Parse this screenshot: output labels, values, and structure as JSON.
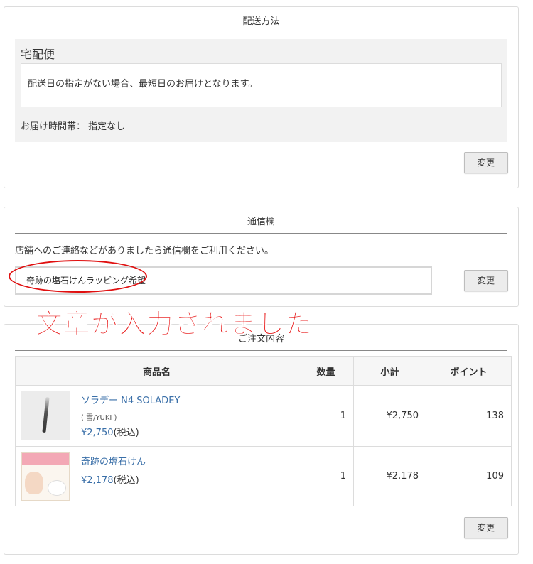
{
  "delivery": {
    "title": "配送方法",
    "method": "宅配便",
    "note": "配送日の指定がない場合、最短日のお届けとなります。",
    "time_label": "お届け時間帯：",
    "time_value": "指定なし",
    "change_label": "変更"
  },
  "message": {
    "title": "通信欄",
    "description": "店舗へのご連絡などがありましたら通信欄をご利用ください。",
    "input_value": "奇跡の塩石けんラッピング希望",
    "change_label": "変更",
    "highlight_color": "#e01010"
  },
  "annotation": {
    "text": "文章が入力されました",
    "color": "#e81818"
  },
  "order": {
    "title": "ご注文内容",
    "columns": [
      "商品名",
      "数量",
      "小計",
      "ポイント"
    ],
    "items": [
      {
        "name": "ソラデー N4 SOLADEY",
        "variant": "( 雪/YUKI )",
        "price": "¥2,750",
        "tax": "(税込)",
        "quantity": "1",
        "subtotal": "¥2,750",
        "points": "138"
      },
      {
        "name": "奇跡の塩石けん",
        "price": "¥2,178",
        "tax": "(税込)",
        "quantity": "1",
        "subtotal": "¥2,178",
        "points": "109"
      }
    ],
    "change_label": "変更",
    "link_color": "#3a6fa8"
  }
}
